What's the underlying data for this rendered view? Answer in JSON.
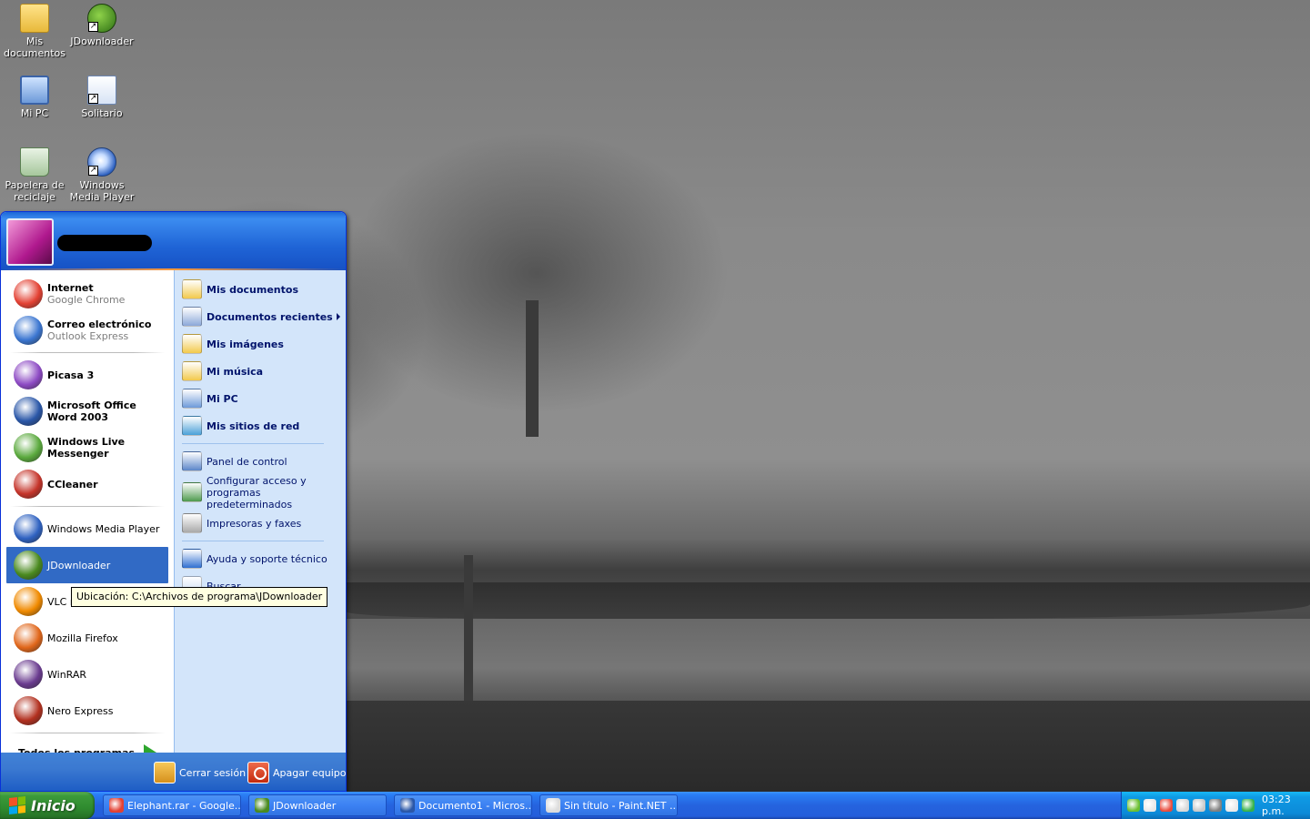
{
  "desktop": {
    "icons": [
      {
        "label": "Mis documentos",
        "icon": "folder-icon"
      },
      {
        "label": "JDownloader",
        "icon": "jdownloader-icon"
      },
      {
        "label": "Mi PC",
        "icon": "my-computer-icon"
      },
      {
        "label": "Solitario",
        "icon": "solitaire-icon"
      },
      {
        "label": "Papelera de reciclaje",
        "icon": "recycle-bin-icon"
      },
      {
        "label": "Windows Media Player",
        "icon": "media-player-icon"
      }
    ]
  },
  "start_menu": {
    "pinned": [
      {
        "title": "Internet",
        "subtitle": "Google Chrome",
        "icon": "chrome-icon",
        "color": "#e34133"
      },
      {
        "title": "Correo electrónico",
        "subtitle": "Outlook Express",
        "icon": "outlook-express-icon",
        "color": "#3b76d1"
      }
    ],
    "recent": [
      {
        "title": "Picasa 3",
        "icon": "picasa-icon",
        "color": "#8d4ac4"
      },
      {
        "title": "Microsoft Office Word 2003",
        "icon": "word-icon",
        "color": "#2a57a8"
      },
      {
        "title": "Windows Live Messenger",
        "icon": "messenger-icon",
        "color": "#5aa93d"
      },
      {
        "title": "CCleaner",
        "icon": "ccleaner-icon",
        "color": "#c5342a"
      }
    ],
    "more": [
      {
        "title": "Windows Media Player",
        "icon": "media-player-icon",
        "color": "#2f62c1"
      },
      {
        "title": "JDownloader",
        "icon": "jdownloader-icon",
        "color": "#4a8a1f",
        "selected": true
      },
      {
        "title": "VLC me",
        "icon": "vlc-icon",
        "color": "#f08a00"
      },
      {
        "title": "Mozilla Firefox",
        "icon": "firefox-icon",
        "color": "#e0661a"
      },
      {
        "title": "WinRAR",
        "icon": "winrar-icon",
        "color": "#6a3b8f"
      },
      {
        "title": "Nero Express",
        "icon": "nero-icon",
        "color": "#b2301f"
      }
    ],
    "all_programs": "Todos los programas",
    "places": [
      {
        "label": "Mis documentos",
        "icon": "folder-icon",
        "color": "#f2c94c",
        "bold": true
      },
      {
        "label": "Documentos recientes",
        "icon": "recent-documents-icon",
        "color": "#8ba8d9",
        "bold": true,
        "submenu": true
      },
      {
        "label": "Mis imágenes",
        "icon": "pictures-folder-icon",
        "color": "#f2c94c",
        "bold": true
      },
      {
        "label": "Mi música",
        "icon": "music-folder-icon",
        "color": "#f2c94c",
        "bold": true
      },
      {
        "label": "Mi PC",
        "icon": "my-computer-icon",
        "color": "#6d9ad9",
        "bold": true
      },
      {
        "label": "Mis sitios de red",
        "icon": "network-places-icon",
        "color": "#4aa0d8",
        "bold": true
      }
    ],
    "system": [
      {
        "label": "Panel de control",
        "icon": "control-panel-icon",
        "color": "#5b86c9"
      },
      {
        "label": "Configurar acceso y programas predeterminados",
        "icon": "default-programs-icon",
        "color": "#4e9a4e"
      },
      {
        "label": "Impresoras y faxes",
        "icon": "printer-icon",
        "color": "#a9a9a9"
      }
    ],
    "help": [
      {
        "label": "Ayuda y soporte técnico",
        "icon": "help-icon",
        "color": "#2f6fd1"
      },
      {
        "label": "Buscar",
        "icon": "search-icon",
        "color": "#c7d9f2"
      }
    ],
    "logoff": "Cerrar sesión",
    "shutdown": "Apagar equipo"
  },
  "tooltip": "Ubicación: C:\\Archivos de programa\\JDownloader",
  "taskbar": {
    "start_label": "Inicio",
    "tasks": [
      {
        "label": "Elephant.rar - Google...",
        "icon": "chrome-icon",
        "color": "#e34133"
      },
      {
        "label": "JDownloader",
        "icon": "jdownloader-icon",
        "color": "#4a8a1f"
      },
      {
        "label": "Documento1 - Micros...",
        "icon": "word-icon",
        "color": "#2a57a8"
      },
      {
        "label": "Sin título - Paint.NET ...",
        "icon": "paint-net-icon",
        "color": "#dcdcdc"
      }
    ],
    "tray_icons": [
      {
        "icon": "jdownloader-tray-icon",
        "color": "#6bbf2f"
      },
      {
        "icon": "network-tray-icon",
        "color": "#e8e8e8"
      },
      {
        "icon": "volume-tray-icon",
        "color": "#e94b3c"
      },
      {
        "icon": "nero-tray-icon",
        "color": "#d8d8d8"
      },
      {
        "icon": "antivirus-tray-icon",
        "color": "#c9c9c9"
      },
      {
        "icon": "media-tray-icon",
        "color": "#7f7f7f"
      },
      {
        "icon": "safely-remove-tray-icon",
        "color": "#eaeaea"
      },
      {
        "icon": "security-tray-icon",
        "color": "#35b24a"
      }
    ],
    "clock": "03:23 p.m."
  }
}
